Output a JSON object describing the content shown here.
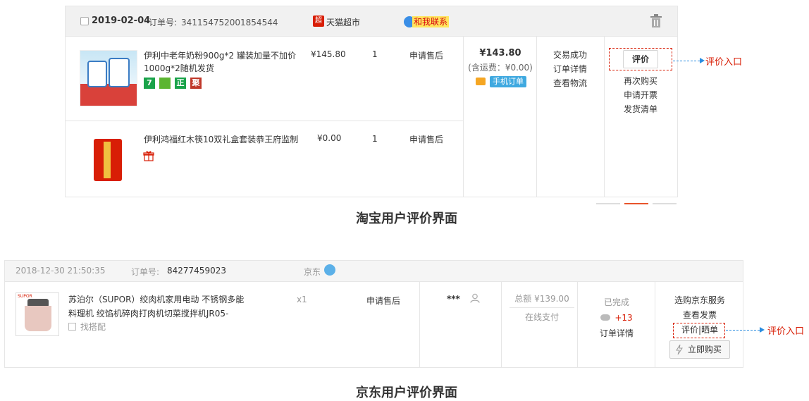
{
  "taobao": {
    "date": "2019-02-04",
    "order_label": "订单号:",
    "order_no": "341154752001854544",
    "shop_logo_char": "超",
    "shop_name": "天猫超市",
    "contact": "和我联系",
    "icons": [
      "checkbox-icon",
      "trash-icon",
      "chat-icon",
      "gift-icon",
      "card-icon"
    ],
    "items": [
      {
        "title": "伊利中老年奶粉900g*2 罐装加量不加价1000g*2随机发货",
        "price": "¥145.80",
        "qty": "1",
        "after_sale": "申请售后",
        "badges": [
          {
            "text": "7",
            "color": "#1aa34a"
          },
          {
            "text": "",
            "color": "#5cb531"
          },
          {
            "text": "正",
            "color": "#1aa34a"
          },
          {
            "text": "聚",
            "color": "#c0392b"
          }
        ]
      },
      {
        "title": "伊利鸿福红木筷10双礼盒套装恭王府监制",
        "price": "¥0.00",
        "qty": "1",
        "after_sale": "申请售后"
      }
    ],
    "total": "¥143.80",
    "shipping": "(含运费：¥0.00)",
    "mobile_order": "手机订单",
    "status_lines": [
      "交易成功",
      "订单详情",
      "查看物流"
    ],
    "rate_button": "评价",
    "ops": [
      "再次购买",
      "申请开票",
      "发货清单"
    ],
    "annotation": "评价入口",
    "caption": "淘宝用户评价界面"
  },
  "jd": {
    "date": "2018-12-30 21:50:35",
    "order_label": "订单号:",
    "order_no": "84277459023",
    "shop": "京东",
    "image_brand": "SUPOR",
    "title": "苏泊尔（SUPOR）绞肉机家用电动 不锈钢多能料理机 绞馅机碎肉打肉机切菜搅拌机JR05-",
    "match": "找搭配",
    "qty": "x1",
    "after_sale": "申请售后",
    "user": "***",
    "total": "总额 ¥139.00",
    "pay": "在线支付",
    "status": "已完成",
    "points": "+13",
    "detail": "订单详情",
    "ops": [
      "选购京东服务",
      "查看发票"
    ],
    "rate": "评价|晒单",
    "buy": "立即购买",
    "icons": [
      "chat-icon",
      "user-icon",
      "cloud-icon",
      "bolt-icon",
      "match-icon"
    ],
    "annotation": "评价入口",
    "caption": "京东用户评价界面"
  },
  "colors": {
    "accent_red": "#d81e06",
    "arrow_blue": "#2a8de0",
    "mobile_badge": "#3fa9e0",
    "contact_bg": "#ffe55c"
  }
}
